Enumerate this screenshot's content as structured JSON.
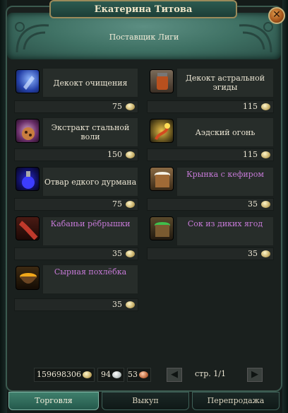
{
  "window": {
    "title": "Екатерина Титова",
    "subtitle": "Поставщик Лиги",
    "close_glyph": "✕"
  },
  "items": [
    {
      "name": "Декокт очищения",
      "price": "75",
      "color": "white",
      "icon": "purification-decoction-icon"
    },
    {
      "name": "Декокт астральной эгиды",
      "price": "115",
      "color": "white",
      "icon": "astral-aegis-decoction-icon"
    },
    {
      "name": "Экстракт стальной воли",
      "price": "150",
      "color": "white",
      "icon": "steel-will-extract-icon"
    },
    {
      "name": "Аэдский огонь",
      "price": "115",
      "color": "white",
      "icon": "aedian-fire-icon"
    },
    {
      "name": "Отвар едкого дурмана",
      "price": "75",
      "color": "white",
      "icon": "caustic-datura-brew-icon"
    },
    {
      "name": "Крынка с кефиром",
      "price": "35",
      "color": "purple",
      "icon": "kefir-jug-icon"
    },
    {
      "name": "Кабаньи рёбрышки",
      "price": "35",
      "color": "purple",
      "icon": "boar-ribs-icon"
    },
    {
      "name": "Сок из диких ягод",
      "price": "35",
      "color": "purple",
      "icon": "wild-berry-juice-icon"
    },
    {
      "name": "Сырная похлёбка",
      "price": "35",
      "color": "purple",
      "icon": "cheese-soup-icon"
    }
  ],
  "wallet": {
    "gold": "159698306",
    "silver": "94",
    "copper": "53"
  },
  "pagination": {
    "prev_glyph": "◀",
    "next_glyph": "▶",
    "label": "стр. 1/1"
  },
  "tabs": [
    {
      "label": "Торговля",
      "active": true
    },
    {
      "label": "Выкуп",
      "active": false
    },
    {
      "label": "Перепродажа",
      "active": false
    }
  ]
}
